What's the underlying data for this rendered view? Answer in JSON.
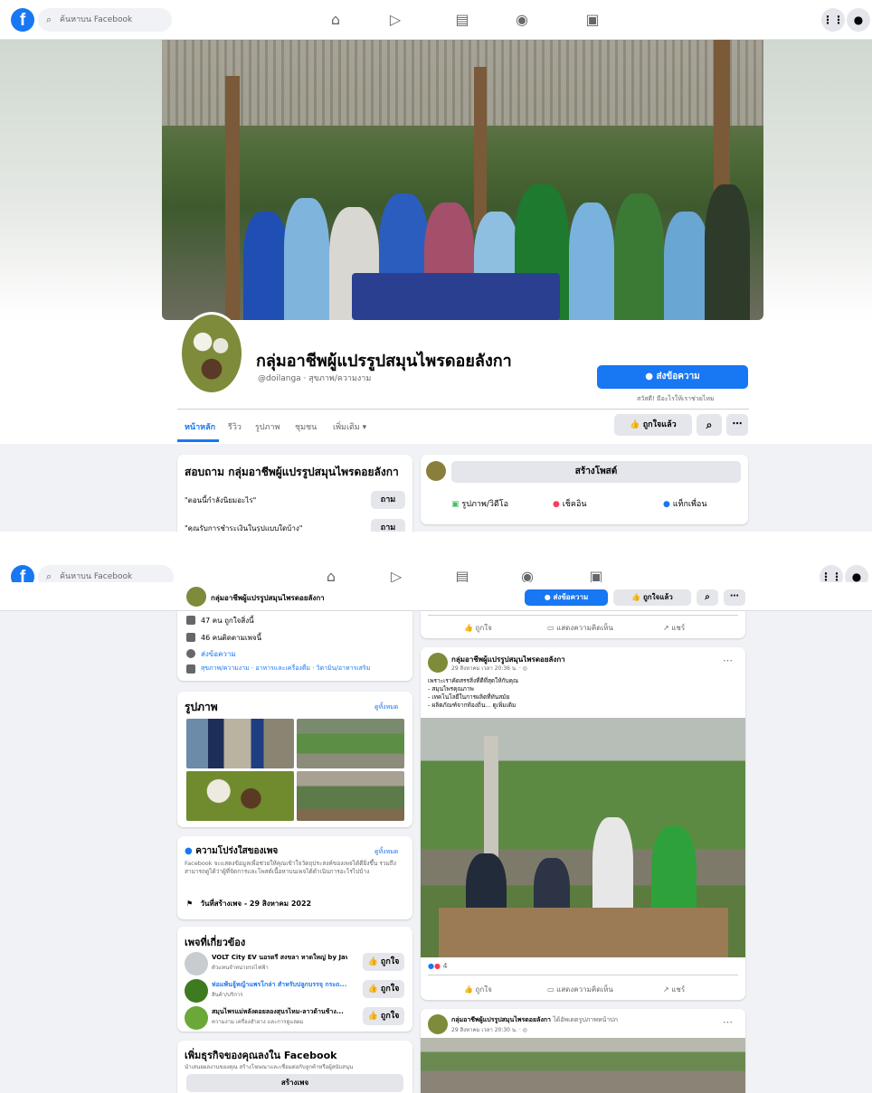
{
  "topbar": {
    "search_placeholder": "ค้นหาบน Facebook",
    "icons": [
      "home-icon",
      "watch-icon",
      "marketplace-icon",
      "groups-icon",
      "gaming-icon"
    ]
  },
  "page": {
    "name": "กลุ่มอาชีพผู้แปรรูปสมุนไพรดอยลังกา",
    "handle": "@doilanga · สุขภาพ/ความงาม",
    "send_message": "ส่งข้อความ",
    "send_message_note": "สวัสดี! มีอะไรให้เราช่วยไหม",
    "liked": "ถูกใจแล้ว",
    "tabs": [
      "หน้าหลัก",
      "รีวิว",
      "รูปภาพ",
      "ชุมชน",
      "เพิ่มเติม ▾"
    ]
  },
  "ask_card": {
    "title": "สอบถาม กลุ่มอาชีพผู้แปรรูปสมุนไพรดอยลังกา",
    "q1": "\"ตอนนี้กำลังนิยมอะไร\"",
    "q2": "\"คุณรับการชำระเงินในรูปแบบใดบ้าง\"",
    "ask_label": "ถาม"
  },
  "composer": {
    "create_post": "สร้างโพสต์",
    "photo_video": "รูปภาพ/วิดีโอ",
    "checkin": "เช็คอิน",
    "tag_friends": "แท็กเพื่อน"
  },
  "sticky": {
    "name": "กลุ่มอาชีพผู้แปรรูปสมุนไพรดอยลังกา",
    "send_message": "ส่งข้อความ",
    "liked": "ถูกใจแล้ว"
  },
  "about": {
    "likes": "47 คน ถูกใจสิ่งนี้",
    "followers": "46 คนติดตามเพจนี้",
    "send_message": "ส่งข้อความ",
    "categories": "สุขภาพ/ความงาม · อาหารและเครื่องดื่ม · วิตามิน/อาหารเสริม"
  },
  "photos": {
    "title": "รูปภาพ",
    "see_all": "ดูทั้งหมด"
  },
  "transparency": {
    "title": "ความโปร่งใสของเพจ",
    "see_all": "ดูทั้งหมด",
    "body": "Facebook จะแสดงข้อมูลเพื่อช่วยให้คุณเข้าใจวัตถุประสงค์ของเพจได้ดียิ่งขึ้น รวมถึงสามารถดูได้ว่าผู้ที่จัดการและโพสต์เนื้อหาบนเพจได้ดำเนินการอะไรไปบ้าง",
    "created": "วันที่สร้างเพจ - 29 สิงหาคม 2022"
  },
  "related": {
    "title": "เพจที่เกี่ยวข้อง",
    "like_label": "ถูกใจ",
    "items": [
      {
        "name": "VOLT City EV นอรดรี สงขลา หาดใหญ่ by Jaw...",
        "sub": "ตัวแทนจำหน่ายรถไฟฟ้า"
      },
      {
        "name": "ห่อแพ้นจู้หญ้าแพรโกล่า สำหรับปลูกบรรจุ กระถ...",
        "sub": "สินค้า/บริการ"
      },
      {
        "name": "สมุนไพรแม่หลังดอยลองสุนรไหม-ลาวด้านช้าง...",
        "sub": "ความงาม เครื่องสำอาง และการดูแลผม"
      }
    ]
  },
  "business": {
    "title": "เพิ่มธุรกิจของคุณลงใน Facebook",
    "body": "นำเสนอผลงานของคุณ สร้างโฆษณาและเชื่อมต่อกับลูกค้าหรือผู้สนับสนุน",
    "create_page": "สร้างเพจ"
  },
  "post_actions": {
    "like": "ถูกใจ",
    "comment": "แสดงความคิดเห็น",
    "share": "แชร์"
  },
  "post1": {
    "author": "กลุ่มอาชีพผู้แปรรูปสมุนไพรดอยลังกา",
    "time": "29 สิงหาคม เวลา 20:36 น. · ",
    "line1": "เพราะเราคัดสรรสิ่งที่ดีที่สุดให้กับคุณ",
    "line2": "- สมุนไพรคุณภาพ",
    "line3": "- เทคโนโลยีในการผลิตที่ทันสมัย",
    "line4": "- ผลิตภัณฑ์จากท้องถิ่น... ดูเพิ่มเติม",
    "reactions": "4"
  },
  "post2": {
    "author": "กลุ่มอาชีพผู้แปรรูปสมุนไพรดอยลังกา",
    "suffix": "ได้อัพเดตรูปภาพหน้าปก",
    "time": "29 สิงหาคม เวลา 20:30 น. · "
  },
  "colors": {
    "accent": "#1877f2",
    "background": "#f0f2f5",
    "card": "#ffffff"
  }
}
